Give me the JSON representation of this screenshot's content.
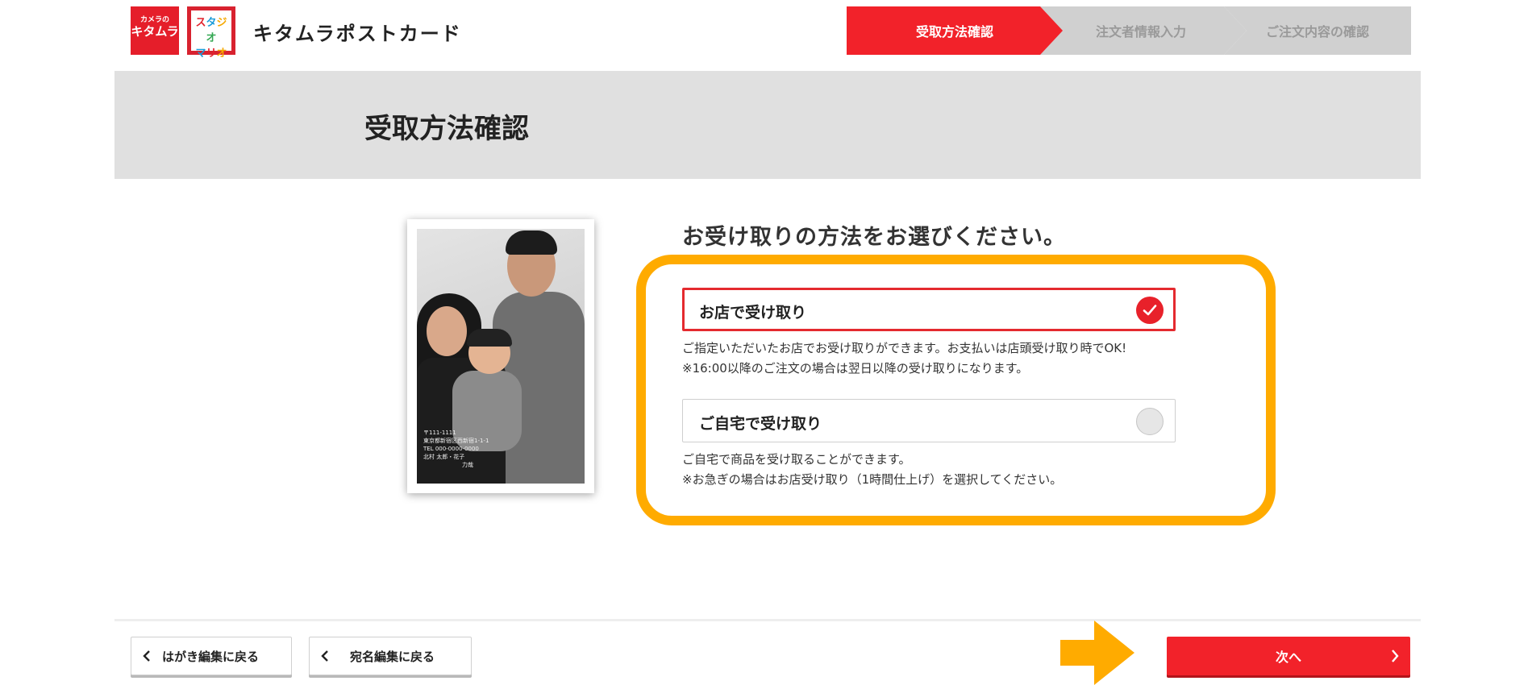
{
  "header": {
    "logo_kitamura": {
      "small": "カメラの",
      "main": "キタムラ"
    },
    "logo_studio": {
      "line1": [
        "ス",
        "タ",
        "ジ",
        "オ"
      ],
      "line2": [
        "マ",
        "リ",
        "オ"
      ]
    },
    "brand": "キタムラポストカード"
  },
  "steps": [
    {
      "label": "受取方法確認",
      "active": true
    },
    {
      "label": "注文者情報入力",
      "active": false
    },
    {
      "label": "ご注文内容の確認",
      "active": false
    }
  ],
  "page_title": "受取方法確認",
  "photo": {
    "address_lines": [
      "〒111-1111",
      "東京都新宿区西新宿1-1-1",
      "TEL 000-0000-0000",
      "北村 太郎・花子",
      "力哉"
    ]
  },
  "question": "お受け取りの方法をお選びください。",
  "options": [
    {
      "label": "お店で受け取り",
      "selected": true,
      "desc": [
        "ご指定いただいたお店でお受け取りができます。お支払いは店頭受け取り時でOK!",
        "※16:00以降のご注文の場合は翌日以降の受け取りになります。"
      ]
    },
    {
      "label": "ご自宅で受け取り",
      "selected": false,
      "desc": [
        "ご自宅で商品を受け取ることができます。",
        "※お急ぎの場合はお店受け取り（1時間仕上げ）を選択してください。"
      ]
    }
  ],
  "footer": {
    "back_to_postcard": "はがき編集に戻る",
    "back_to_address": "宛名編集に戻る",
    "next": "次へ"
  },
  "colors": {
    "accent_red": "#f2222a",
    "highlight_orange": "#ffab00",
    "step_inactive": "#d0d0d0",
    "title_band": "#e0e0e0"
  },
  "icons": {
    "check": "check-icon",
    "chevron_left": "chevron-left-icon",
    "chevron_right": "chevron-right-icon",
    "pointer_arrow": "arrow-right-icon"
  }
}
